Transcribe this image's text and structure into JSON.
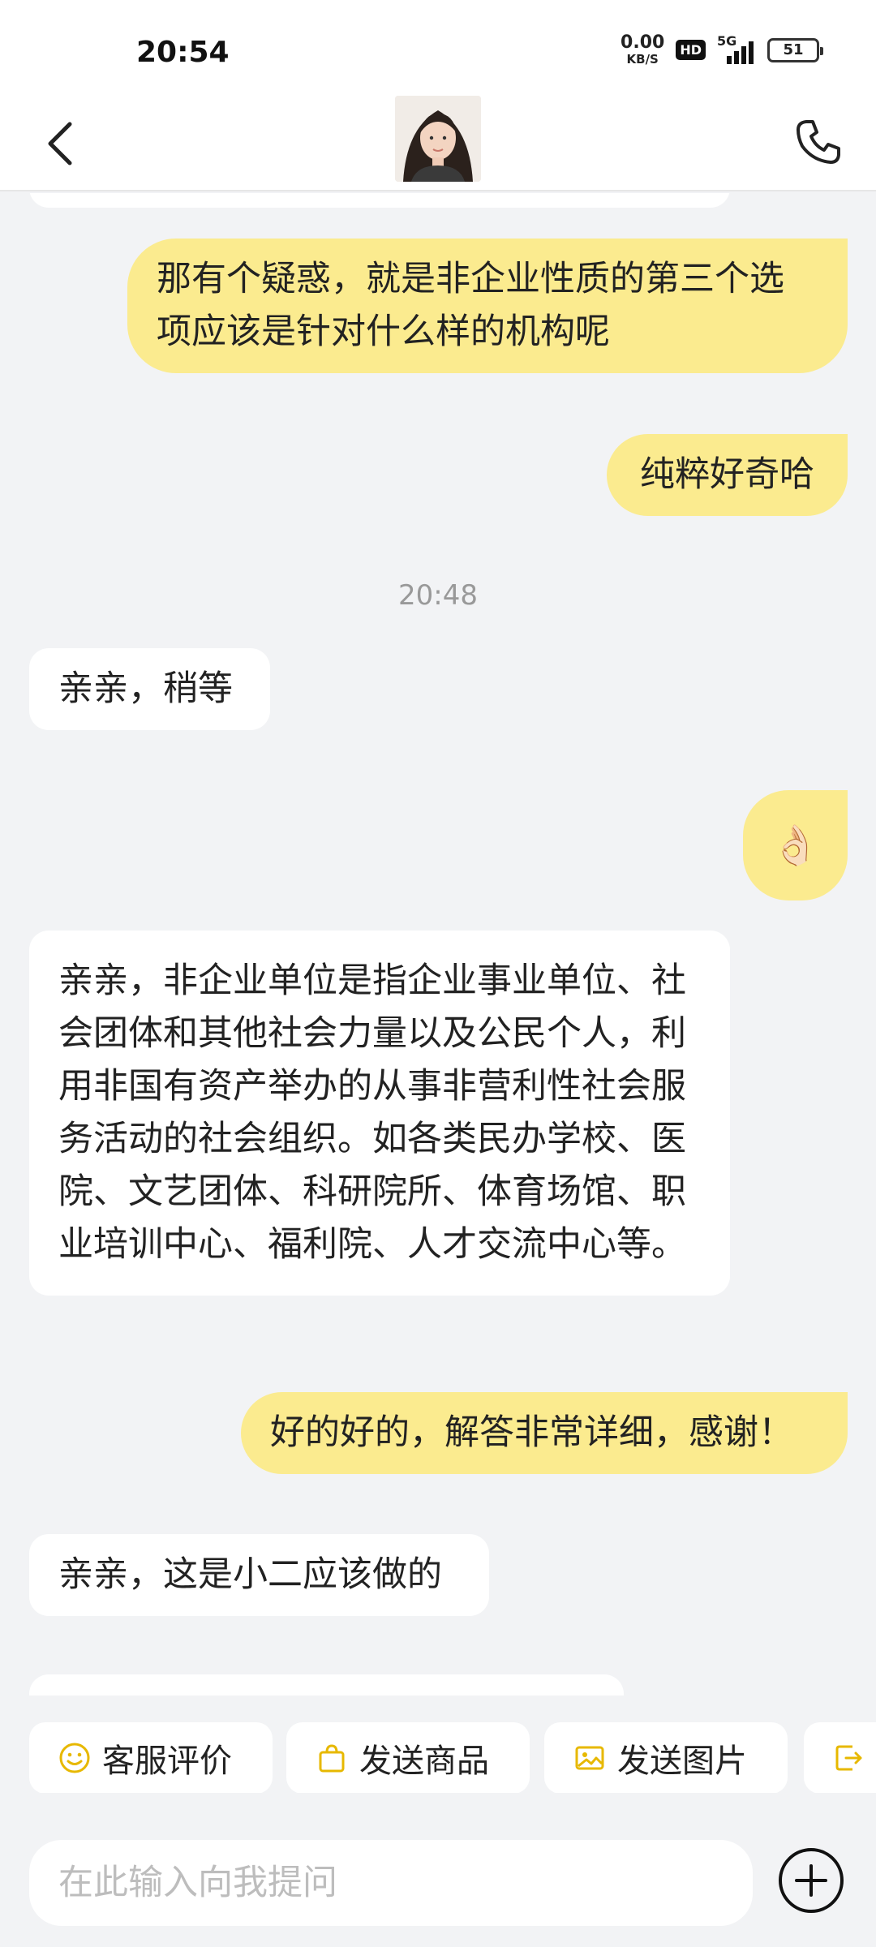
{
  "status": {
    "time": "20:54",
    "net_speed_value": "0.00",
    "net_speed_unit": "KB/S",
    "hd": "HD",
    "network": "5G",
    "battery": "51"
  },
  "header": {
    "back_icon": "chevron-left-icon",
    "call_icon": "phone-icon",
    "avatar": "agent-avatar"
  },
  "chat": {
    "messages": [
      {
        "side": "out",
        "text": "那有个疑惑，就是非企业性质的第三个选项应该是针对什么样的机构呢"
      },
      {
        "side": "out",
        "text": "纯粹好奇哈"
      },
      {
        "side": "in",
        "text": "亲亲，稍等"
      },
      {
        "side": "out",
        "text": "👌🏻"
      },
      {
        "side": "in",
        "text": "亲亲，非企业单位是指企业事业单位、社会团体和其他社会力量以及公民个人，利用非国有资产举办的从事非营利性社会服务活动的社会组织。如各类民办学校、医院、文艺团体、科研院所、体育场馆、职业培训中心、福利院、人才交流中心等。"
      },
      {
        "side": "out",
        "text": "好的好的，解答非常详细，感谢！"
      },
      {
        "side": "in",
        "text": "亲亲，这是小二应该做的"
      }
    ],
    "timestamp": "20:48"
  },
  "quick_actions": [
    {
      "label": "客服评价",
      "icon": "smiley-icon"
    },
    {
      "label": "发送商品",
      "icon": "shopping-bag-icon"
    },
    {
      "label": "发送图片",
      "icon": "image-icon"
    },
    {
      "label": "",
      "icon": "exit-icon"
    }
  ],
  "input": {
    "placeholder": "在此输入向我提问",
    "value": ""
  },
  "colors": {
    "outgoing_bubble": "#fbeb8f",
    "incoming_bubble": "#ffffff",
    "background": "#f2f3f5",
    "accent_icon": "#e7b800"
  }
}
